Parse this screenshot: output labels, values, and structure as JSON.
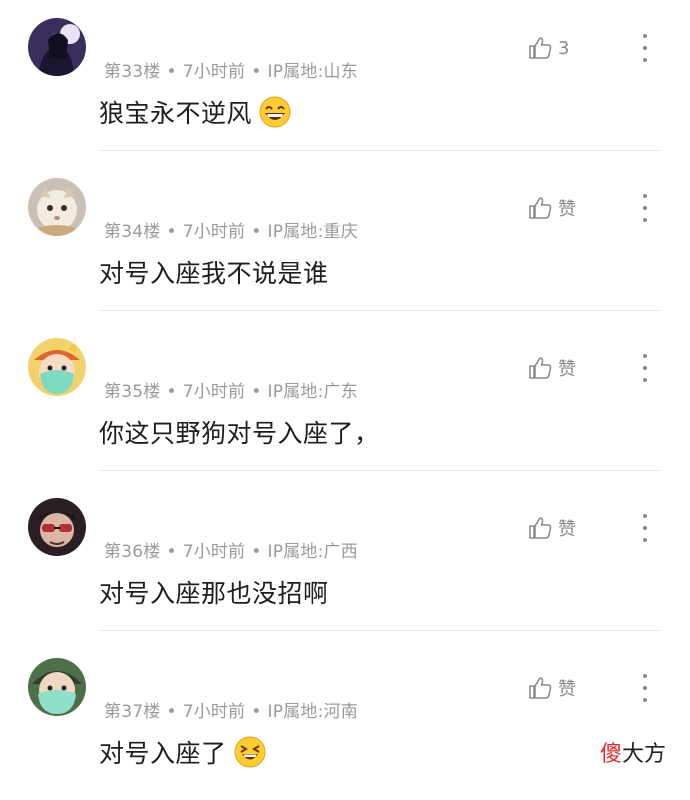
{
  "comments": [
    {
      "floor": "第33楼",
      "time": "7小时前",
      "location": "IP属地:山东",
      "text": "狼宝永不逆风",
      "like": "3",
      "emoji": "grinning-face-emoji"
    },
    {
      "floor": "第34楼",
      "time": "7小时前",
      "location": "IP属地:重庆",
      "text": "对号入座我不说是谁",
      "like": "赞",
      "emoji": ""
    },
    {
      "floor": "第35楼",
      "time": "7小时前",
      "location": "IP属地:广东",
      "text": "你这只野狗对号入座了，",
      "like": "赞",
      "emoji": ""
    },
    {
      "floor": "第36楼",
      "time": "7小时前",
      "location": "IP属地:广西",
      "text": "对号入座那也没招啊",
      "like": "赞",
      "emoji": ""
    },
    {
      "floor": "第37楼",
      "time": "7小时前",
      "location": "IP属地:河南",
      "text": "对号入座了",
      "like": "赞",
      "emoji": "grinning-squint-face-emoji"
    }
  ],
  "separator": "•",
  "watermark": {
    "part1": "傻",
    "part2": "大方"
  },
  "colors": {
    "meta": "#9a9a9a",
    "text": "#1e1e1e",
    "watermark_red": "#e02a2a",
    "emoji_yellow": "#ffcc33"
  }
}
